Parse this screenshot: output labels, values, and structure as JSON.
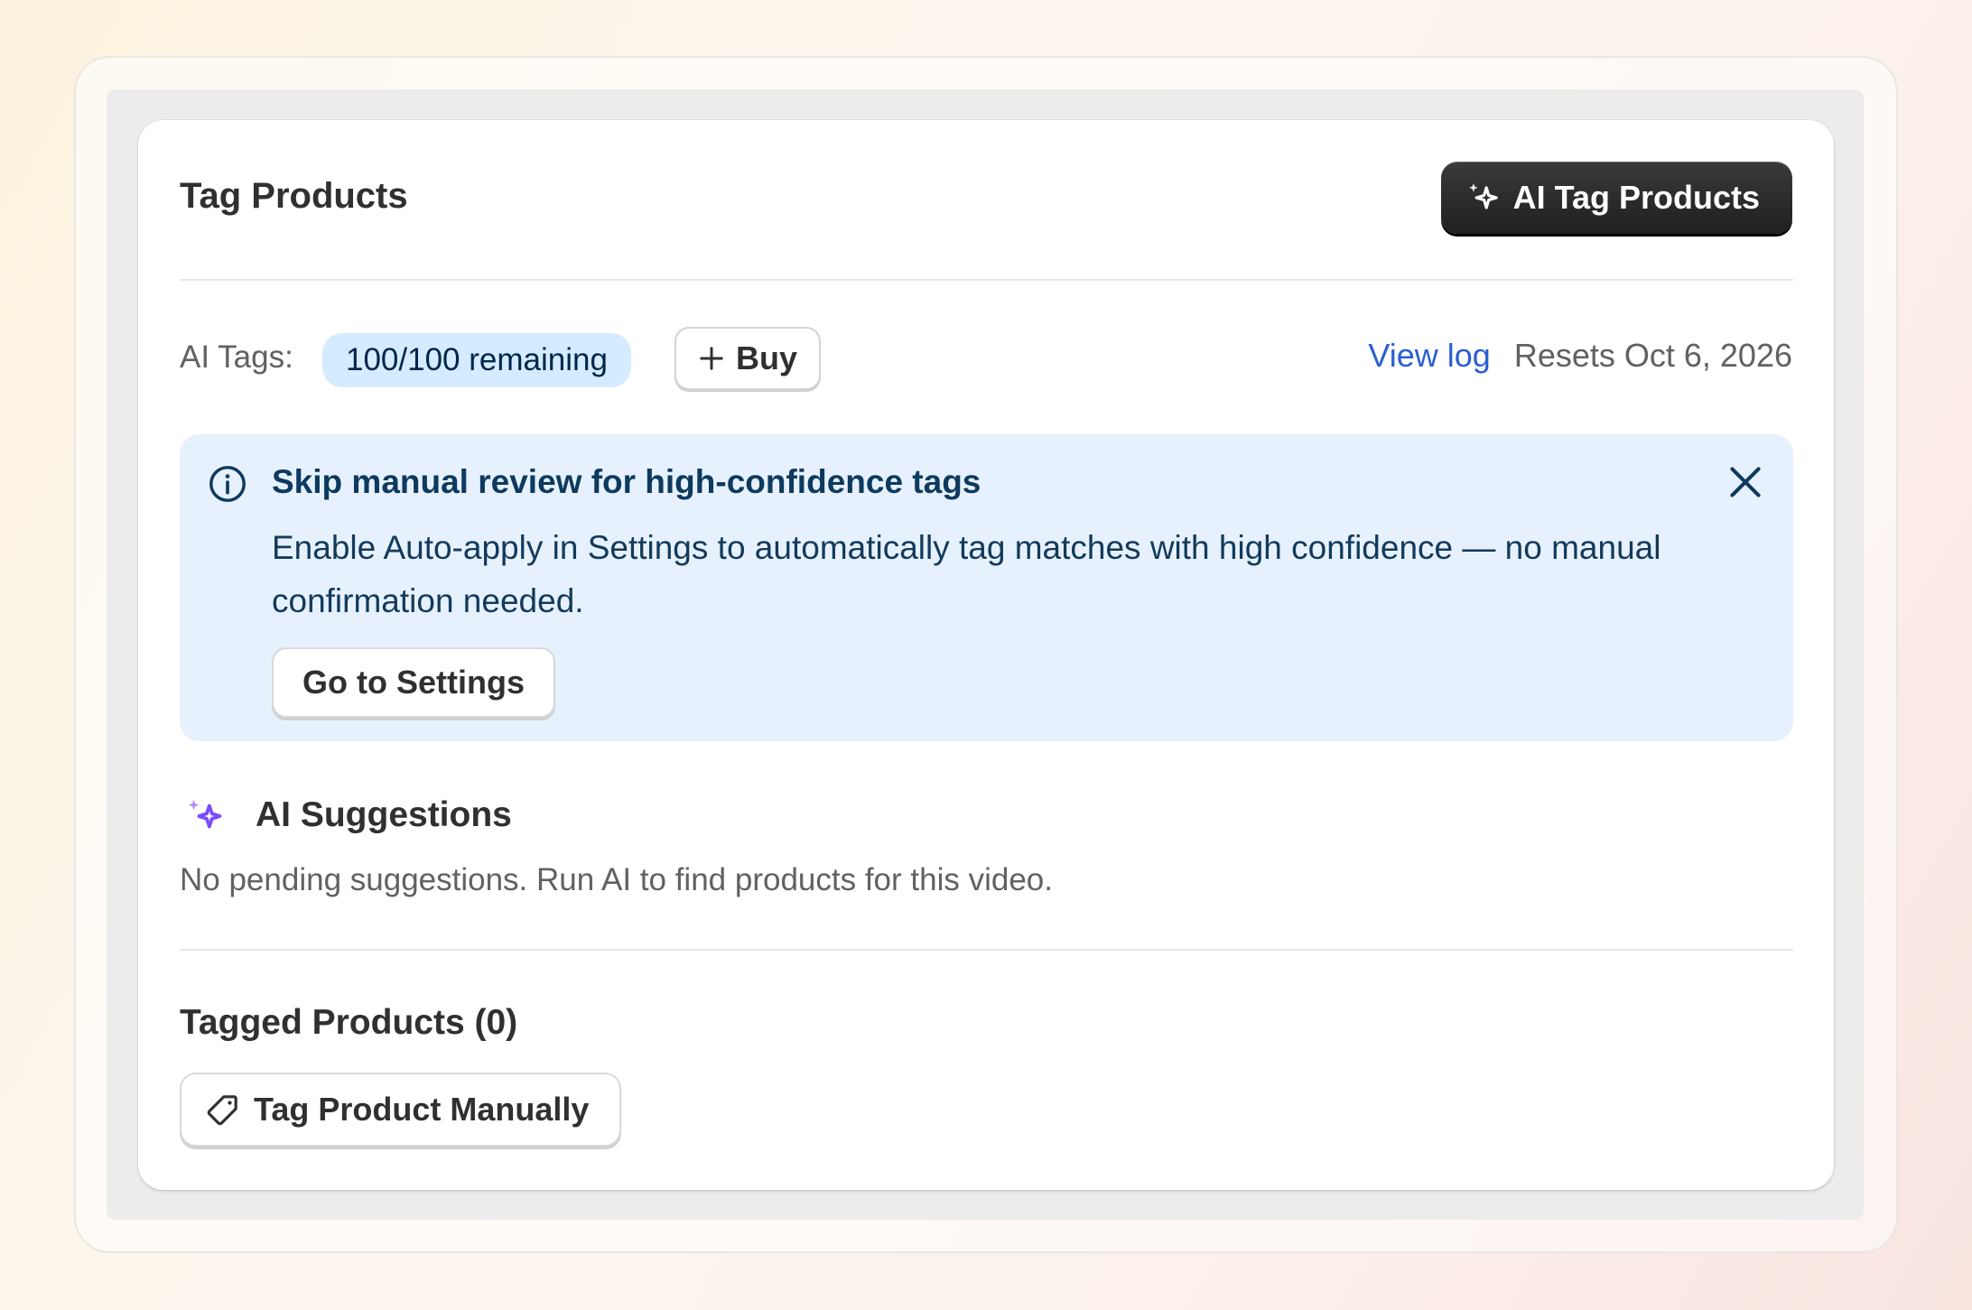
{
  "card": {
    "title": "Tag Products",
    "ai_button_label": "AI Tag Products"
  },
  "usage": {
    "label": "AI Tags:",
    "remaining": "100/100 remaining",
    "buy_label": "Buy",
    "view_log": "View log",
    "resets": "Resets Oct 6, 2026"
  },
  "banner": {
    "title": "Skip manual review for high-confidence tags",
    "body": "Enable Auto-apply in Settings to automatically tag matches with high confidence — no manual confirmation needed.",
    "button_label": "Go to Settings"
  },
  "suggestions": {
    "title": "AI Suggestions",
    "empty_text": "No pending suggestions. Run AI to find products for this video."
  },
  "tagged": {
    "title": "Tagged Products (0)",
    "manual_button_label": "Tag Product Manually"
  },
  "colors": {
    "accent_purple": "#7c4dff",
    "link_blue": "#2a5fd1",
    "banner_bg": "#e6f1fd",
    "badge_bg": "#d5ebff"
  },
  "icons": {
    "ai_button": "sparkle-icon",
    "buy": "plus-icon",
    "banner": "info-icon",
    "dismiss": "close-icon",
    "suggestions": "sparkle-icon",
    "manual": "tag-icon"
  }
}
